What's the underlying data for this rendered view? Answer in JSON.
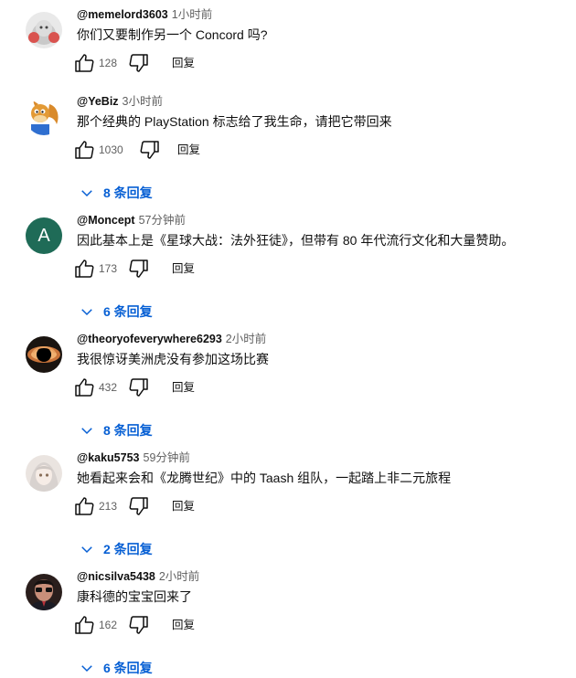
{
  "ui": {
    "reply_label": "回复"
  },
  "comments": [
    {
      "author": "@memelord3603",
      "time": "1小时前",
      "text": "你们又要制作另一个 Concord 吗?",
      "likes": "128",
      "replies": "",
      "avatar_icon": "grey-creature-avatar"
    },
    {
      "author": "@YeBiz",
      "time": "3小时前",
      "text": "那个经典的 PlayStation 标志给了我生命，请把它带回来",
      "likes": "1030",
      "replies": "8 条回复",
      "avatar_icon": "squirrel-avatar"
    },
    {
      "author": "@Moncept",
      "time": "57分钟前",
      "text": "因此基本上是《星球大战：法外狂徒》，但带有 80 年代流行文化和大量赞助。",
      "likes": "173",
      "replies": "6 条回复",
      "avatar_letter": "A",
      "avatar_color": "#1f6b57"
    },
    {
      "author": "@theoryofeverywhere6293",
      "time": "2小时前",
      "text": "我很惊讶美洲虎没有参加这场比赛",
      "likes": "432",
      "replies": "8 条回复",
      "avatar_icon": "black-hole-avatar"
    },
    {
      "author": "@kaku5753",
      "time": "59分钟前",
      "text": "她看起来会和《龙腾世纪》中的 Taash 组队，一起踏上非二元旅程",
      "likes": "213",
      "replies": "2 条回复",
      "avatar_icon": "anime-girl-avatar"
    },
    {
      "author": "@nicsilva5438",
      "time": "2小时前",
      "text": "康科德的宝宝回来了",
      "likes": "162",
      "replies": "6 条回复",
      "avatar_icon": "man-glasses-avatar"
    }
  ]
}
